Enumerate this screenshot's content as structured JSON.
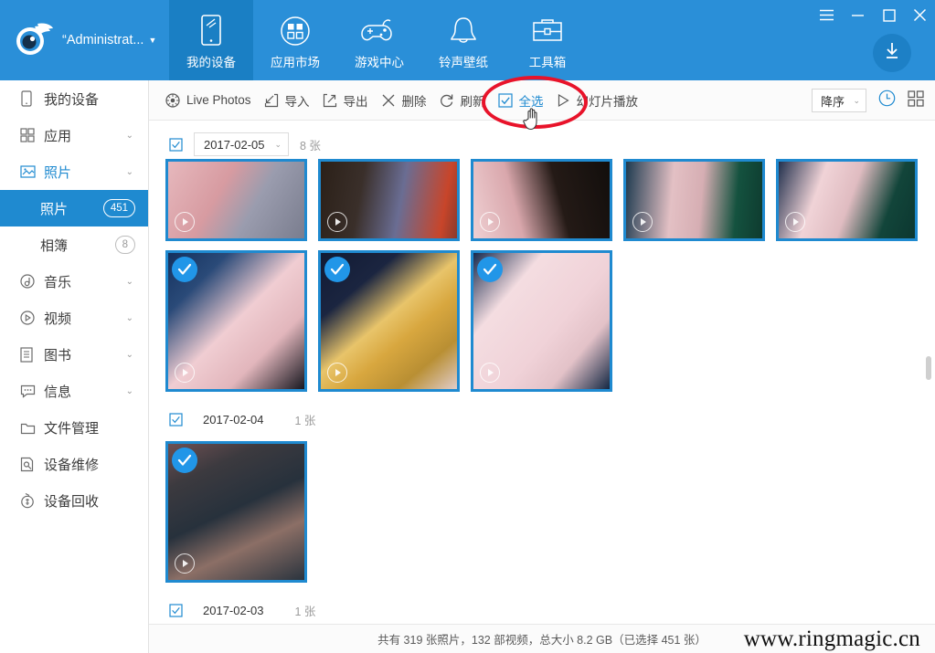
{
  "header": {
    "account": "“Administrat...",
    "logo_icon": "eye-swoosh-logo",
    "caret_icon": "caret-down-icon",
    "download_icon": "download-arrow-icon",
    "window_controls": [
      {
        "name": "menu-button",
        "icon": "hamburger-icon"
      },
      {
        "name": "minimize-button",
        "icon": "minimize-icon"
      },
      {
        "name": "maximize-button",
        "icon": "maximize-icon"
      },
      {
        "name": "close-button",
        "icon": "close-icon"
      }
    ],
    "tabs": [
      {
        "label": "我的设备",
        "icon": "tablet-icon",
        "active": true
      },
      {
        "label": "应用市场",
        "icon": "apps-grid-circle-icon",
        "active": false
      },
      {
        "label": "游戏中心",
        "icon": "gamepad-icon",
        "active": false
      },
      {
        "label": "铃声壁纸",
        "icon": "bell-icon",
        "active": false
      },
      {
        "label": "工具箱",
        "icon": "toolbox-icon",
        "active": false
      }
    ]
  },
  "sidebar": {
    "items": [
      {
        "label": "我的设备",
        "icon": "device-icon",
        "chevron": false,
        "accent": false
      },
      {
        "label": "应用",
        "icon": "apps-icon",
        "chevron": true,
        "accent": false
      },
      {
        "label": "照片",
        "icon": "photo-icon",
        "chevron": true,
        "accent": true
      },
      {
        "label": "音乐",
        "icon": "music-icon",
        "chevron": true,
        "accent": false
      },
      {
        "label": "视频",
        "icon": "video-icon",
        "chevron": true,
        "accent": false
      },
      {
        "label": "图书",
        "icon": "book-icon",
        "chevron": true,
        "accent": false
      },
      {
        "label": "信息",
        "icon": "message-icon",
        "chevron": true,
        "accent": false
      },
      {
        "label": "文件管理",
        "icon": "folder-icon",
        "chevron": false,
        "accent": false
      },
      {
        "label": "设备维修",
        "icon": "repair-icon",
        "chevron": false,
        "accent": false
      },
      {
        "label": "设备回收",
        "icon": "recycle-money-icon",
        "chevron": false,
        "accent": false
      }
    ],
    "sub_items": [
      {
        "label": "照片",
        "badge": "451",
        "selected": true
      },
      {
        "label": "相簿",
        "badge": "8",
        "selected": false
      }
    ]
  },
  "toolbar": {
    "items": [
      {
        "label": "Live Photos",
        "icon": "live-photos-icon",
        "highlighted": false
      },
      {
        "label": "导入",
        "icon": "import-icon",
        "highlighted": false
      },
      {
        "label": "导出",
        "icon": "export-icon",
        "highlighted": false
      },
      {
        "label": "删除",
        "icon": "delete-x-icon",
        "highlighted": false
      },
      {
        "label": "刷新",
        "icon": "refresh-icon",
        "highlighted": false
      },
      {
        "label": "全选",
        "icon": "checkbox-icon",
        "highlighted": true
      },
      {
        "label": "幻灯片播放",
        "icon": "play-triangle-icon",
        "highlighted": false
      }
    ],
    "sort_value": "降序",
    "sort_caret_icon": "chevron-down-icon",
    "clock_icon": "clock-icon",
    "grid_icon": "grid-view-icon"
  },
  "content": {
    "groups": [
      {
        "date": "2017-02-05",
        "count": "8 张",
        "date_is_dropdown": true,
        "checked": true,
        "thumbs": [
          {
            "name": "thumb-1",
            "selected": false,
            "video": true,
            "tall": false,
            "colors": [
              "#d9a7ac",
              "#8c8fa0",
              "#6c6f80"
            ]
          },
          {
            "name": "thumb-2",
            "selected": false,
            "video": true,
            "tall": false,
            "colors": [
              "#2b2018",
              "#5b5f88",
              "#c8452a"
            ]
          },
          {
            "name": "thumb-3",
            "selected": false,
            "video": true,
            "tall": false,
            "colors": [
              "#1a1410",
              "#e3bcbf",
              "#c79094"
            ]
          },
          {
            "name": "thumb-4",
            "selected": false,
            "video": true,
            "tall": false,
            "colors": [
              "#1d3a4f",
              "#e3c0c4",
              "#14523f"
            ]
          },
          {
            "name": "thumb-5",
            "selected": false,
            "video": true,
            "tall": false,
            "colors": [
              "#1b2d4a",
              "#efd2d6",
              "#0f4436"
            ]
          },
          {
            "name": "thumb-6",
            "selected": true,
            "video": true,
            "tall": true,
            "colors": [
              "#13305c",
              "#f0cdd2",
              "#1b1b26"
            ]
          },
          {
            "name": "thumb-7",
            "selected": true,
            "video": true,
            "tall": true,
            "colors": [
              "#0f1730",
              "#e8c46a",
              "#d8a73f"
            ]
          },
          {
            "name": "thumb-8",
            "selected": true,
            "video": true,
            "tall": true,
            "colors": [
              "#15294d",
              "#f2d8dd",
              "#10243f"
            ]
          }
        ]
      },
      {
        "date": "2017-02-04",
        "count": "1 张",
        "date_is_dropdown": false,
        "checked": true,
        "thumbs": [
          {
            "name": "thumb-9",
            "selected": true,
            "video": true,
            "tall": true,
            "colors": [
              "#1c2530",
              "#6e5a58",
              "#2b343e"
            ]
          }
        ]
      },
      {
        "date": "2017-02-03",
        "count": "1 张",
        "date_is_dropdown": false,
        "checked": true,
        "thumbs": []
      }
    ]
  },
  "statusbar": {
    "text": "共有 319 张照片，132 部视频，总大小 8.2 GB（已选择 451 张）"
  },
  "watermark": "www.ringmagic.cn",
  "annotation": {
    "ellipse_color": "#e8132a",
    "cursor_icon": "pointing-hand-cursor"
  },
  "colors": {
    "header_blue": "#2a8fd8",
    "active_tab_blue": "#1a7fc4",
    "accent_blue": "#1f8ad0",
    "select_blue": "#2196e8"
  }
}
